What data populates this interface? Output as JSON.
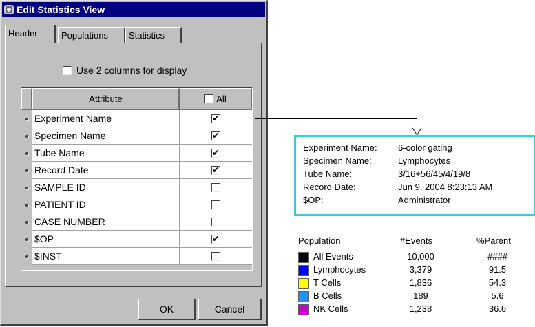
{
  "dialog": {
    "title": "Edit Statistics View",
    "tabs": [
      {
        "label": "Header",
        "active": true
      },
      {
        "label": "Populations",
        "active": false
      },
      {
        "label": "Statistics",
        "active": false
      }
    ],
    "two_column_label": "Use 2 columns for display",
    "two_column_checked": false,
    "grid": {
      "attribute_header": "Attribute",
      "all_header": "All",
      "all_checked": false,
      "rows": [
        {
          "attribute": "Experiment Name",
          "checked": true
        },
        {
          "attribute": "Specimen Name",
          "checked": true
        },
        {
          "attribute": "Tube Name",
          "checked": true
        },
        {
          "attribute": "Record Date",
          "checked": true
        },
        {
          "attribute": "SAMPLE ID",
          "checked": false
        },
        {
          "attribute": "PATIENT ID",
          "checked": false
        },
        {
          "attribute": "CASE NUMBER",
          "checked": false
        },
        {
          "attribute": "$OP",
          "checked": true
        },
        {
          "attribute": "$INST",
          "checked": false
        }
      ]
    },
    "ok_label": "OK",
    "cancel_label": "Cancel"
  },
  "report": {
    "header_fields": [
      {
        "key": "Experiment Name:",
        "value": "6-color gating"
      },
      {
        "key": "Specimen Name:",
        "value": "Lymphocytes"
      },
      {
        "key": "Tube Name:",
        "value": "3/16+56/45/4/19/8"
      },
      {
        "key": "Record Date:",
        "value": "Jun 9, 2004 8:23:13 AM"
      },
      {
        "key": "$OP:",
        "value": "Administrator"
      }
    ],
    "header_border_color": "#2ad4d4",
    "population_table": {
      "columns": [
        "Population",
        "#Events",
        "%Parent"
      ],
      "rows": [
        {
          "name": "All Events",
          "events": "10,000",
          "parent": "####",
          "color": "#000000"
        },
        {
          "name": "Lymphocytes",
          "events": "3,379",
          "parent": "91.5",
          "color": "#0000ff"
        },
        {
          "name": "T Cells",
          "events": "1,836",
          "parent": "54.3",
          "color": "#ffff00"
        },
        {
          "name": "B Cells",
          "events": "189",
          "parent": "5.6",
          "color": "#1e90ff"
        },
        {
          "name": "NK Cells",
          "events": "1,238",
          "parent": "36.6",
          "color": "#cc00cc"
        }
      ]
    }
  }
}
